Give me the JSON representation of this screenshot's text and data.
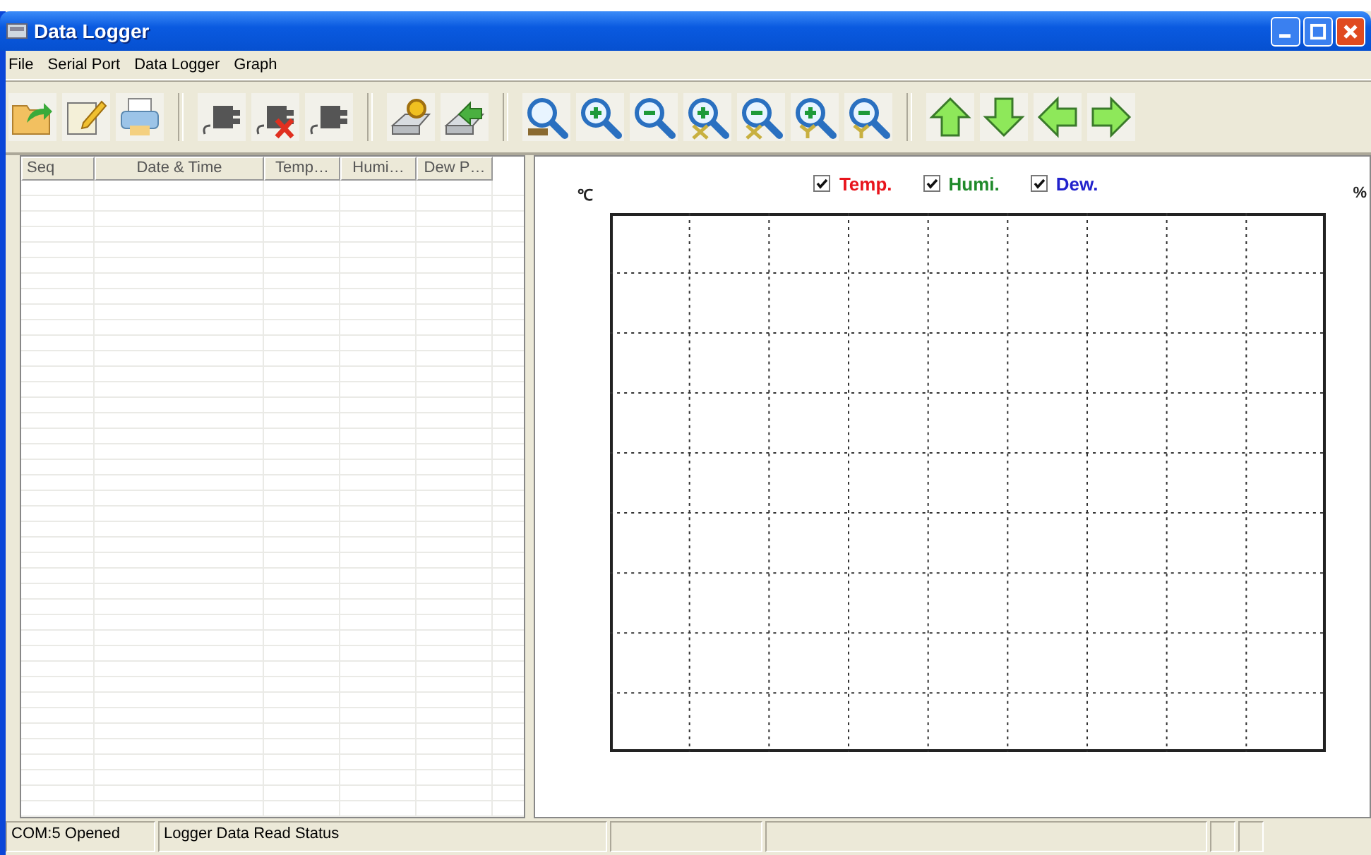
{
  "window": {
    "title": "Data Logger"
  },
  "menu": [
    "File",
    "Serial Port",
    "Data Logger",
    "Graph"
  ],
  "table": {
    "columns": [
      "Seq",
      "Date & Time",
      "Temp…",
      "Humi…",
      "Dew P…"
    ]
  },
  "graph": {
    "left_unit": "℃",
    "right_unit": "%",
    "legend": [
      {
        "label": "Temp.",
        "checked": true,
        "color": "#e8141c"
      },
      {
        "label": "Humi.",
        "checked": true,
        "color": "#1f8a2a"
      },
      {
        "label": "Dew.",
        "checked": true,
        "color": "#2222cc"
      }
    ]
  },
  "status_bar": [
    "COM:5 Opened",
    "Logger Data Read Status"
  ]
}
